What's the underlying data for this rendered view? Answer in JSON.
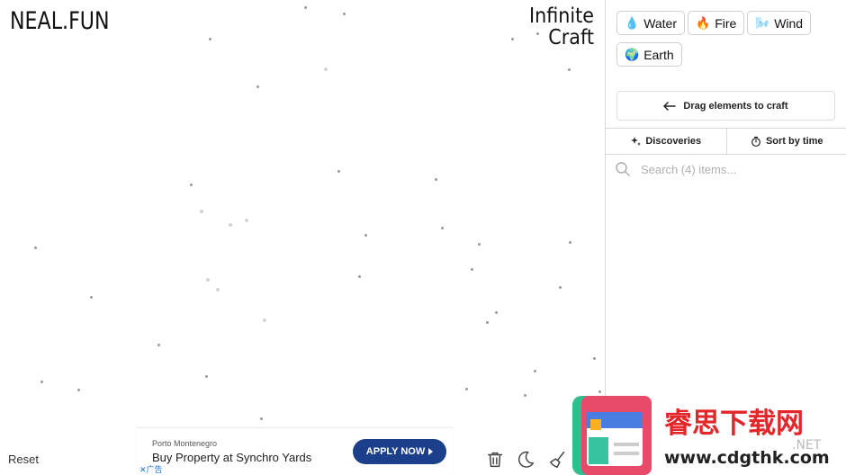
{
  "brand": {
    "neal": "NEAL.FUN",
    "title_line1": "Infinite",
    "title_line2": "Craft"
  },
  "canvas": {
    "reset_label": "Reset"
  },
  "ad": {
    "sponsor": "Porto Montenegro",
    "headline": "Buy Property at Synchro Yards",
    "cta": "APPLY NOW",
    "label": "广告"
  },
  "tools": [
    "trash-icon",
    "moon-icon",
    "broom-icon"
  ],
  "elements": [
    {
      "label": "Water",
      "emoji": "💧"
    },
    {
      "label": "Fire",
      "emoji": "🔥"
    },
    {
      "label": "Wind",
      "emoji": "🌬️"
    },
    {
      "label": "Earth",
      "emoji": "🌍"
    }
  ],
  "sidebar": {
    "drag_hint": "Drag elements to craft",
    "tab_discoveries": "Discoveries",
    "tab_sort": "Sort by time",
    "search_placeholder": "Search (4) items..."
  },
  "watermark": {
    "text_cn": "睿思下载网",
    "text_url": "www.cdgthk.com",
    "net": ".NET"
  },
  "colors": {
    "ad_cta": "#1b3f8a",
    "border": "#d8d8d8",
    "watermark_red": "#e3262a"
  }
}
